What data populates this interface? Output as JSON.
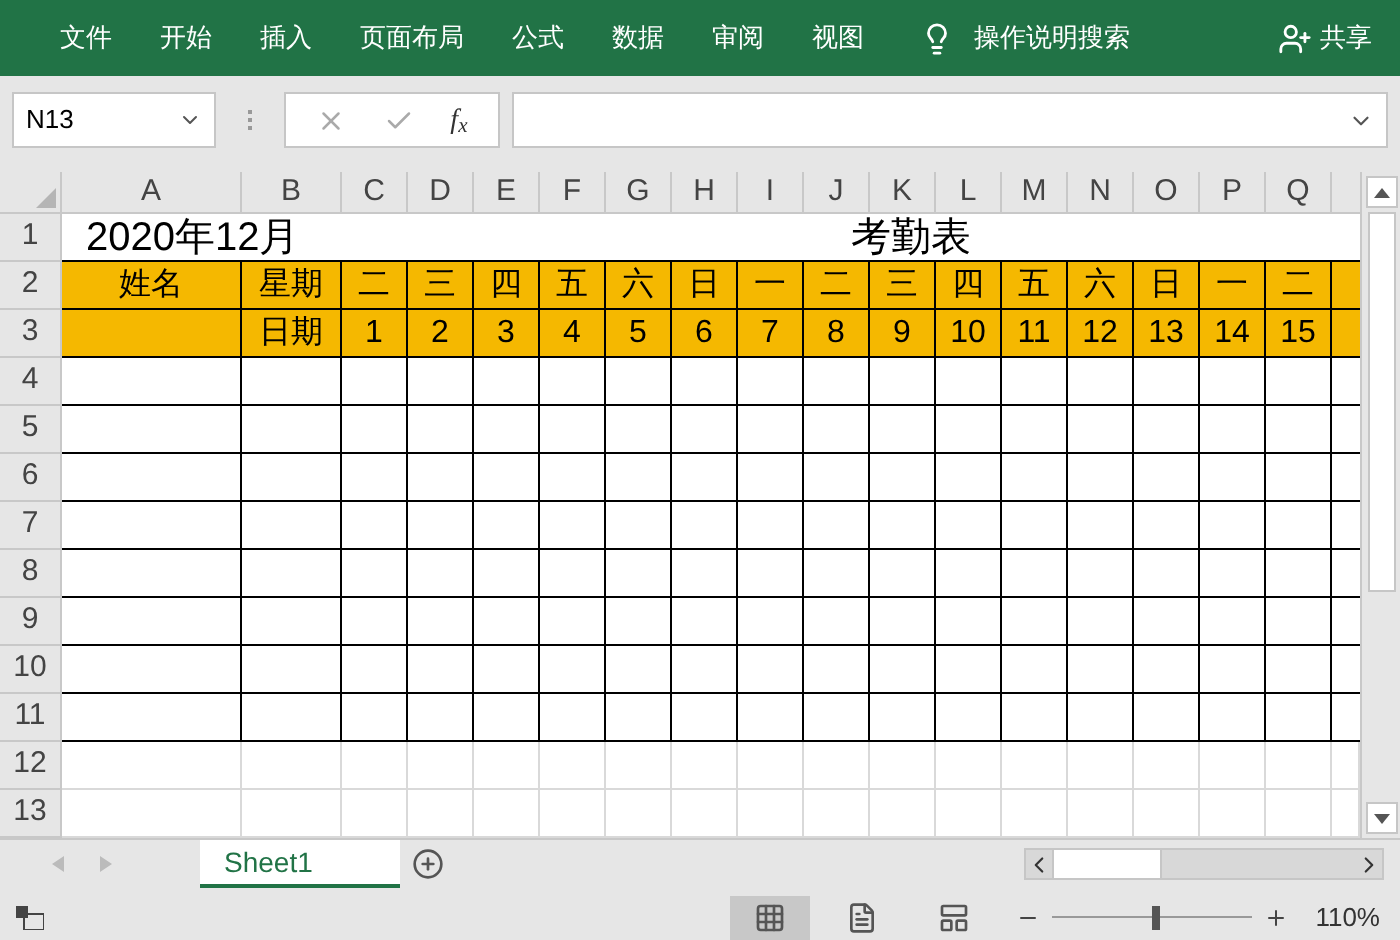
{
  "menu": [
    "文件",
    "开始",
    "插入",
    "页面布局",
    "公式",
    "数据",
    "审阅",
    "视图"
  ],
  "tell_me": "操作说明搜索",
  "share": "共享",
  "name_box": "N13",
  "formula_bar": {
    "function_label": "f$_{x}$"
  },
  "columns": [
    "A",
    "B",
    "C",
    "D",
    "E",
    "F",
    "G",
    "H",
    "I",
    "J",
    "K",
    "L",
    "M",
    "N",
    "O",
    "P",
    "Q"
  ],
  "sheet": {
    "month": "2020年12月",
    "title": "考勤表",
    "name_header": "姓名",
    "weekday_header": "星期",
    "date_header": "日期",
    "weekdays": [
      "二",
      "三",
      "四",
      "五",
      "六",
      "日",
      "一",
      "二",
      "三",
      "四",
      "五",
      "六",
      "日",
      "一",
      "二"
    ],
    "dates": [
      "1",
      "2",
      "3",
      "4",
      "5",
      "6",
      "7",
      "8",
      "9",
      "10",
      "11",
      "12",
      "13",
      "14",
      "15"
    ]
  },
  "rows": [
    {
      "number": "1",
      "kind": "title"
    },
    {
      "number": "2",
      "kind": "weekday"
    },
    {
      "number": "3",
      "kind": "date"
    },
    {
      "number": "4",
      "kind": "blank"
    },
    {
      "number": "5",
      "kind": "blank"
    },
    {
      "number": "6",
      "kind": "blank"
    },
    {
      "number": "7",
      "kind": "blank"
    },
    {
      "number": "8",
      "kind": "blank"
    },
    {
      "number": "9",
      "kind": "blank"
    },
    {
      "number": "10",
      "kind": "blank"
    },
    {
      "number": "11",
      "kind": "blank"
    },
    {
      "number": "12",
      "kind": "empty"
    },
    {
      "number": "13",
      "kind": "empty"
    }
  ],
  "sheet_tabs": [
    {
      "label": "Sheet1",
      "selected": true
    }
  ],
  "view_buttons": [
    {
      "kind": "normal",
      "selected": true
    },
    {
      "kind": "page_layout",
      "selected": false
    },
    {
      "kind": "page_break",
      "selected": false
    }
  ],
  "zoom": {
    "level": 0.52,
    "label": "110%"
  }
}
